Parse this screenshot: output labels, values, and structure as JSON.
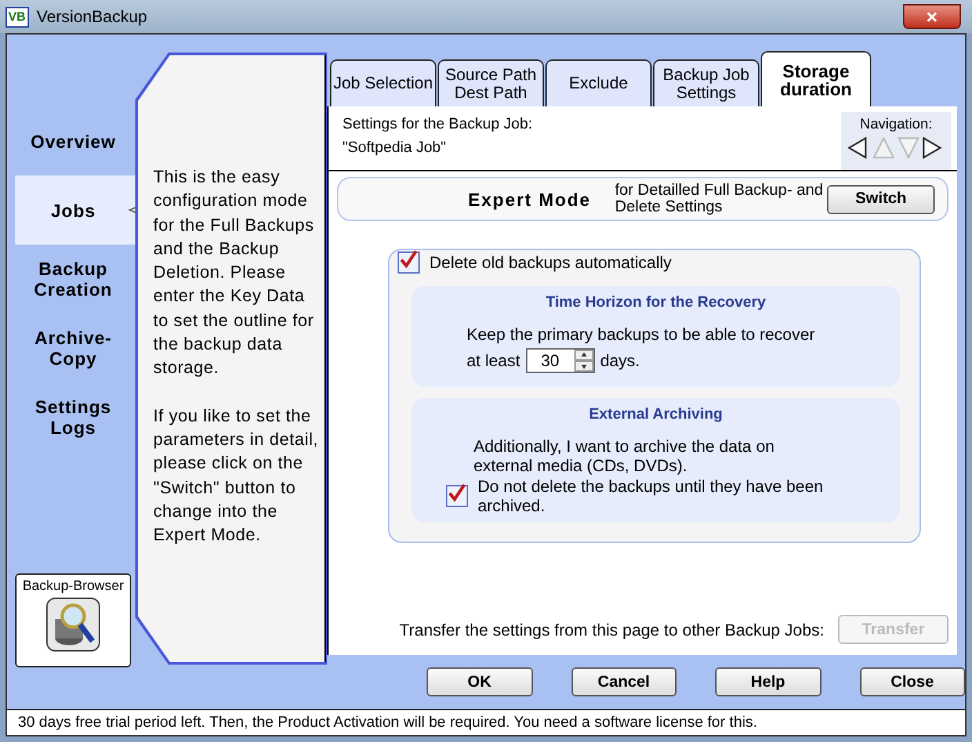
{
  "window": {
    "app_icon": "VB",
    "title": "VersionBackup",
    "close": "×"
  },
  "sidebar": {
    "items": [
      {
        "label": "Overview",
        "selected": false
      },
      {
        "label": "Jobs",
        "selected": true
      },
      {
        "label": "Backup Creation",
        "selected": false
      },
      {
        "label": "Archive-Copy",
        "selected": false
      },
      {
        "label": "Settings Logs",
        "selected": false
      }
    ],
    "browser_button": "Backup-Browser"
  },
  "help_text": [
    "This is the easy configuration mode for the Full Backups and the Backup Deletion. Please enter the Key Data to set the outline for the backup data storage.",
    "If you like to set the parameters in detail, please click on the \"Switch\" button to change into the Expert Mode."
  ],
  "tabs": [
    {
      "label": "Job Selection",
      "selected": false
    },
    {
      "label": "Source Path Dest Path",
      "selected": false
    },
    {
      "label": "Exclude",
      "selected": false
    },
    {
      "label": "Backup Job Settings",
      "selected": false
    },
    {
      "label": "Storage duration",
      "selected": true
    }
  ],
  "job": {
    "caption": "Settings for the Backup Job:",
    "name": "\"Softpedia Job\""
  },
  "navigation": {
    "label": "Navigation:",
    "arrows": [
      {
        "kind": "left",
        "disabled": false
      },
      {
        "kind": "up",
        "disabled": true
      },
      {
        "kind": "down",
        "disabled": true
      },
      {
        "kind": "right",
        "disabled": false
      }
    ]
  },
  "expert": {
    "title": "Expert Mode",
    "description": "for Detailled Full Backup- and Delete Settings",
    "button": "Switch"
  },
  "delete_old": {
    "label": "Delete old backups automatically",
    "checked": true
  },
  "time_horizon": {
    "title": "Time Horizon for the Recovery",
    "text": "Keep the primary backups to be able to recover",
    "prefix": "at least",
    "days": "30",
    "suffix": "days."
  },
  "archiving": {
    "title": "External Archiving",
    "text": "Additionally, I want to archive the data on external media (CDs, DVDs).",
    "keep": {
      "label": "Do not delete the backups until they have been archived.",
      "checked": true
    }
  },
  "transfer": {
    "text": "Transfer the settings from this page to other Backup Jobs:",
    "button": "Transfer",
    "disabled": true
  },
  "buttons": [
    "OK",
    "Cancel",
    "Help",
    "Close"
  ],
  "status_bar": "30 days free trial period left. Then, the Product Activation will be required. You need a software license for this."
}
